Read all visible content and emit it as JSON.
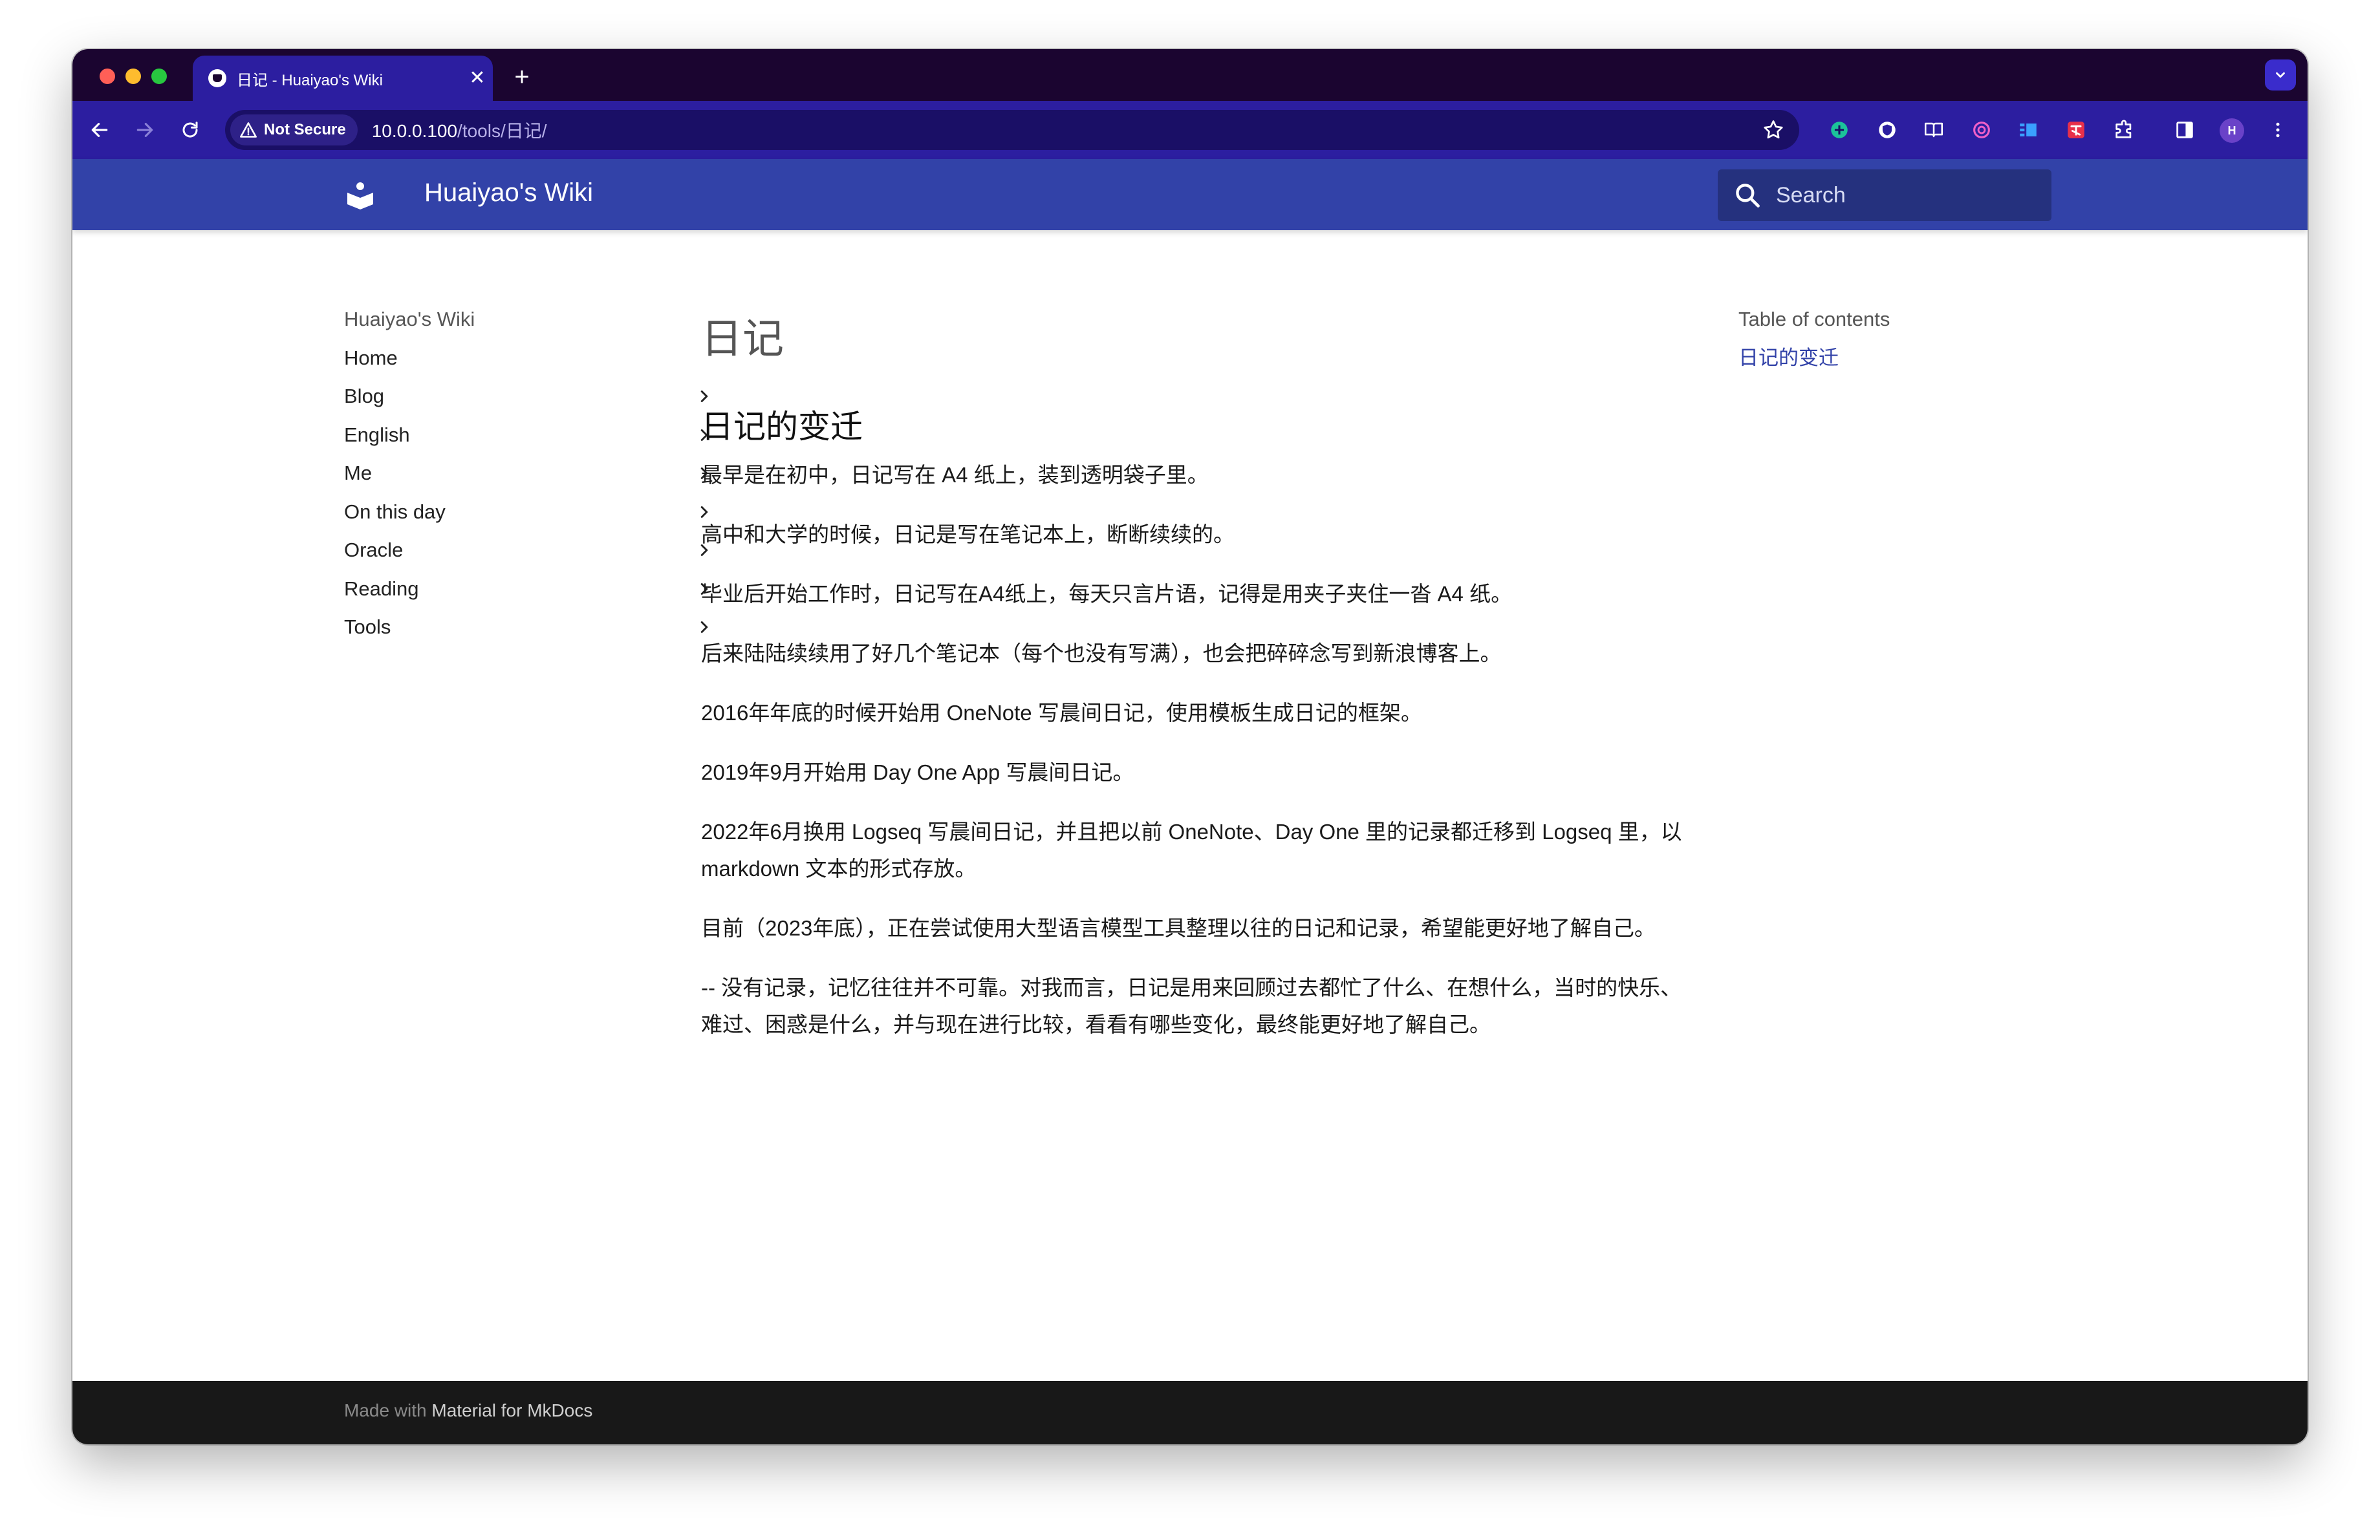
{
  "browser": {
    "tab": {
      "title": "日记 - Huaiyao's Wiki",
      "close_glyph": "✕"
    },
    "new_tab_glyph": "+",
    "address": {
      "security_label": "Not Secure",
      "host": "10.0.0.100",
      "path": "/tools/日记/"
    },
    "profile_initial": "H",
    "colors": {
      "tab_strip": "#1b0530",
      "toolbar": "#2c1ea0"
    }
  },
  "header": {
    "site_title": "Huaiyao's Wiki",
    "search_placeholder": "Search",
    "color": "#3242a8"
  },
  "nav": {
    "site_title": "Huaiyao's Wiki",
    "items": [
      {
        "label": "Home",
        "has_children": false
      },
      {
        "label": "Blog",
        "has_children": true
      },
      {
        "label": "English",
        "has_children": true
      },
      {
        "label": "Me",
        "has_children": true
      },
      {
        "label": "On this day",
        "has_children": true
      },
      {
        "label": "Oracle",
        "has_children": true
      },
      {
        "label": "Reading",
        "has_children": true
      },
      {
        "label": "Tools",
        "has_children": true
      }
    ]
  },
  "article": {
    "title": "日记",
    "section_heading": "日记的变迁",
    "paragraphs": [
      "最早是在初中，日记写在 A4 纸上，装到透明袋子里。",
      "高中和大学的时候，日记是写在笔记本上，断断续续的。",
      "毕业后开始工作时，日记写在A4纸上，每天只言片语，记得是用夹子夹住一沓 A4 纸。",
      "后来陆陆续续用了好几个笔记本（每个也没有写满），也会把碎碎念写到新浪博客上。",
      "2016年年底的时候开始用 OneNote 写晨间日记，使用模板生成日记的框架。",
      "2019年9月开始用 Day One App 写晨间日记。",
      "2022年6月换用 Logseq 写晨间日记，并且把以前 OneNote、Day One 里的记录都迁移到 Logseq 里，以 markdown 文本的形式存放。",
      "目前（2023年底），正在尝试使用大型语言模型工具整理以往的日记和记录，希望能更好地了解自己。",
      "-- 没有记录，记忆往往并不可靠。对我而言，日记是用来回顾过去都忙了什么、在想什么，当时的快乐、难过、困惑是什么，并与现在进行比较，看看有哪些变化，最终能更好地了解自己。"
    ]
  },
  "toc": {
    "title": "Table of contents",
    "items": [
      {
        "label": "日记的变迁"
      }
    ]
  },
  "footer": {
    "prefix": "Made with",
    "link": "Material for MkDocs"
  }
}
